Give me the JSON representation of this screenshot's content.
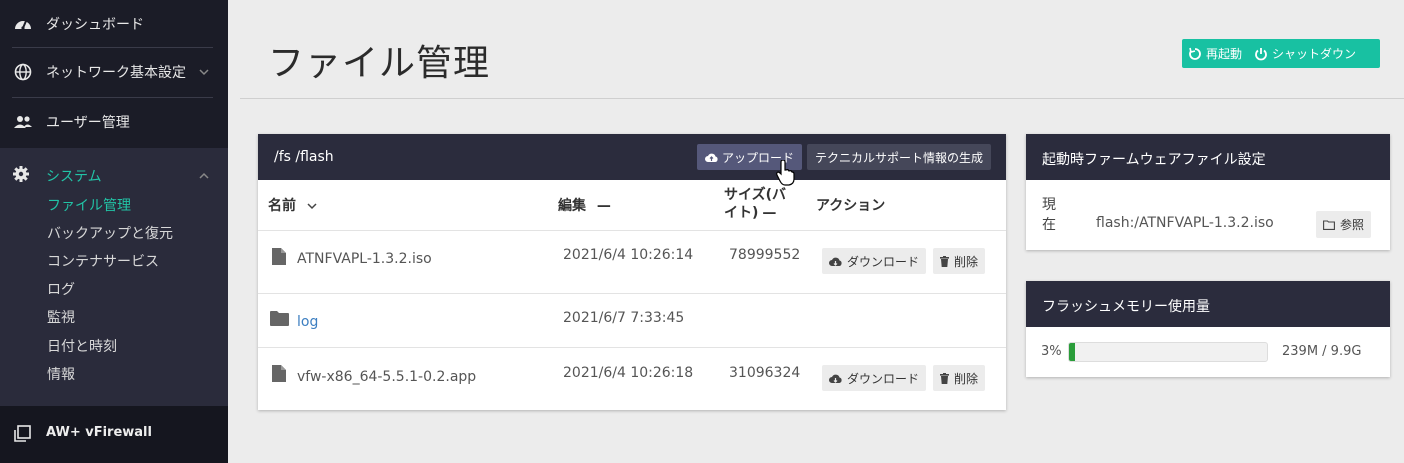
{
  "sidebar": {
    "dashboard": "ダッシュボード",
    "network": "ネットワーク基本設定",
    "users": "ユーザー管理",
    "system": "システム",
    "subitems": [
      "ファイル管理",
      "バックアップと復元",
      "コンテナサービス",
      "ログ",
      "監視",
      "日付と時刻",
      "情報"
    ],
    "brand": "AW+ vFirewall"
  },
  "header": {
    "title": "ファイル管理",
    "restart": "再起動",
    "shutdown": "シャットダウン"
  },
  "files_card": {
    "path": "/fs /flash",
    "upload": "アップロード",
    "techsupport": "テクニカルサポート情報の生成",
    "columns": {
      "name": "名前",
      "edit": "編集",
      "size_line1": "サイズ(バ",
      "size_line2": "イト)",
      "action": "アクション"
    },
    "download_label": "ダウンロード",
    "delete_label": "削除",
    "rows": [
      {
        "name": "ATNFVAPL-1.3.2.iso",
        "date": "2021/6/4 10:26:14",
        "size": "78999552",
        "type": "file"
      },
      {
        "name": "log",
        "date": "2021/6/7 7:33:45",
        "size": "",
        "type": "folder"
      },
      {
        "name": "vfw-x86_64-5.5.1-0.2.app",
        "date": "2021/6/4 10:26:18",
        "size": "31096324",
        "type": "file"
      }
    ]
  },
  "boot_card": {
    "title": "起動時ファームウェアファイル設定",
    "label_line1": "現",
    "label_line2": "在",
    "value": "flash:/ATNFVAPL-1.3.2.iso",
    "browse": "参照"
  },
  "flash_card": {
    "title": "フラッシュメモリー使用量",
    "percent_label": "3%",
    "percent": 3,
    "usage": "239M / 9.9G"
  },
  "colors": {
    "accent": "#18c1a2",
    "sidebar": "#1b1c27",
    "card_header": "#2b2c3d",
    "progress": "#2a9d3a"
  }
}
